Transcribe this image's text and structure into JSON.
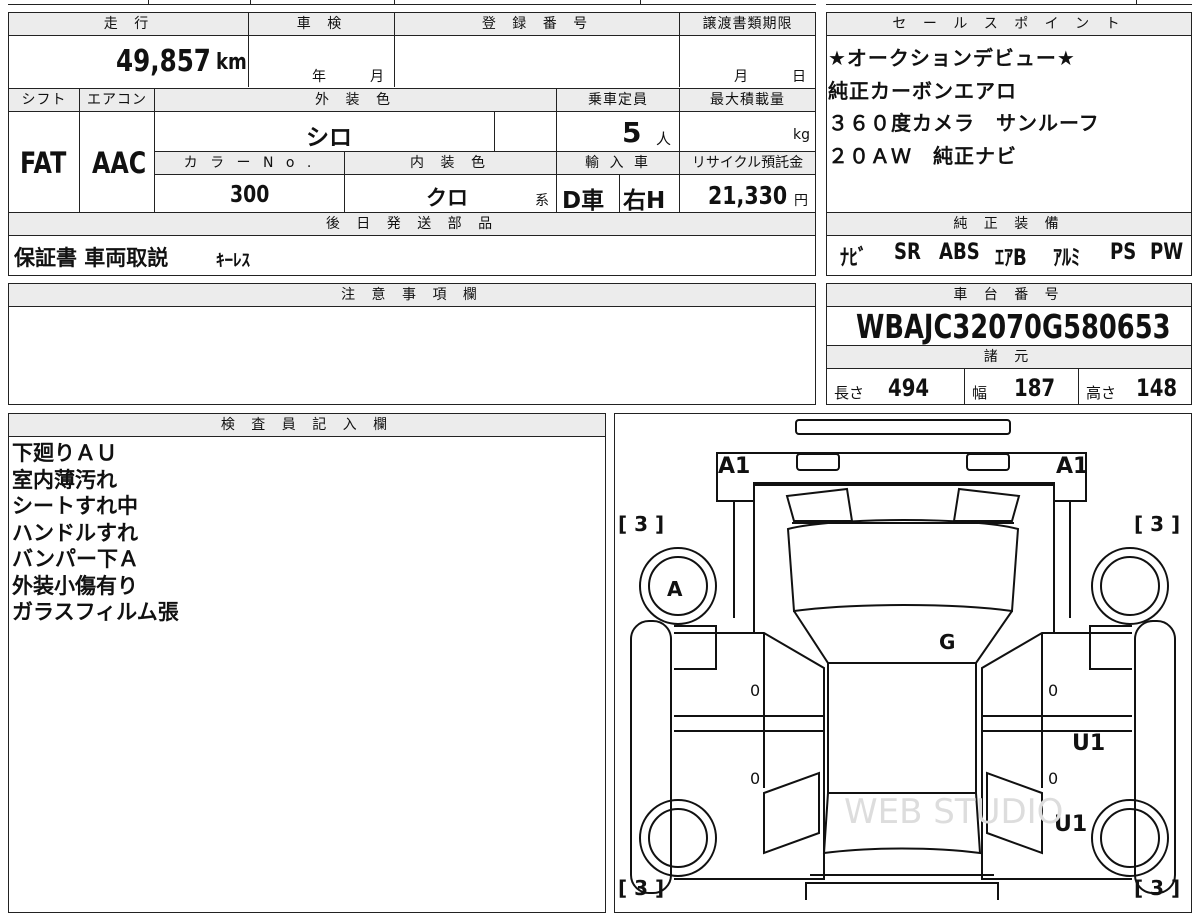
{
  "headers": {
    "mileage": "走 行",
    "inspection": "車 検",
    "registration": "登 録 番 号",
    "transfer_deadline": "譲渡書類期限",
    "shift": "シフト",
    "aircon": "エアコン",
    "exterior_color": "外 装 色",
    "capacity": "乗車定員",
    "max_load": "最大積載量",
    "color_no": "カ ラ ー N o .",
    "interior_color": "内 装 色",
    "import": "輸 入 車",
    "recycle": "リサイクル預託金",
    "later_parts": "後 日 発 送 部 品",
    "cautions": "注 意 事 項 欄",
    "inspector": "検 査 員 記 入 欄",
    "sales_points": "セ ー ル ス ポ イ ン ト",
    "genuine_equipment": "純 正 装 備",
    "chassis_no": "車 台 番 号",
    "specs": "諸 元"
  },
  "vehicle": {
    "mileage": "49,857",
    "mileage_unit": "km",
    "inspection_year_label": "年",
    "inspection_month_label": "月",
    "transfer_month_label": "月",
    "transfer_day_label": "日",
    "shift": "FAT",
    "aircon": "AAC",
    "exterior_color": "シロ",
    "capacity": "5",
    "capacity_unit": "人",
    "max_load_unit": "kg",
    "color_no": "300",
    "interior_color": "クロ",
    "interior_suffix": "系",
    "import_type": "D車",
    "handle": "右H",
    "recycle_fee": "21,330",
    "recycle_unit": "円",
    "later_parts": "保証書 車両取説",
    "later_parts_small": "ｷｰﾚｽ"
  },
  "sales_points": [
    "★オークションデビュー★",
    "純正カーボンエアロ",
    "３６０度カメラ　サンルーフ",
    "２０ＡＷ　純正ナビ"
  ],
  "genuine_equipment": [
    "ﾅﾋﾞ",
    "SR",
    "ABS",
    "ｴｱB",
    "ｱﾙﾐ",
    "PS",
    "PW"
  ],
  "chassis_no": "WBAJC32070G580653",
  "specs": {
    "length_label": "長さ",
    "length": "494",
    "width_label": "幅",
    "width": "187",
    "height_label": "高さ",
    "height": "148"
  },
  "inspector_notes": [
    "下廻りＡＵ",
    "室内薄汚れ",
    "シートすれ中",
    "ハンドルすれ",
    "バンパー下Ａ",
    "外装小傷有り",
    "ガラスフィルム張"
  ],
  "diagram_marks": {
    "front_left": "A1",
    "front_right": "A1",
    "tire_fl": "[ 3 ]",
    "tire_fr": "[ 3 ]",
    "tire_rl": "[ 3 ]",
    "tire_rr": "[ 3 ]",
    "wheel_fl": "A",
    "roof": "G",
    "door_fl": "0",
    "door_rl": "0",
    "door_fr": "0",
    "door_rr": "0",
    "right_front_door": "U1",
    "right_rear": "U1",
    "watermark": "WEB STUDIO"
  }
}
